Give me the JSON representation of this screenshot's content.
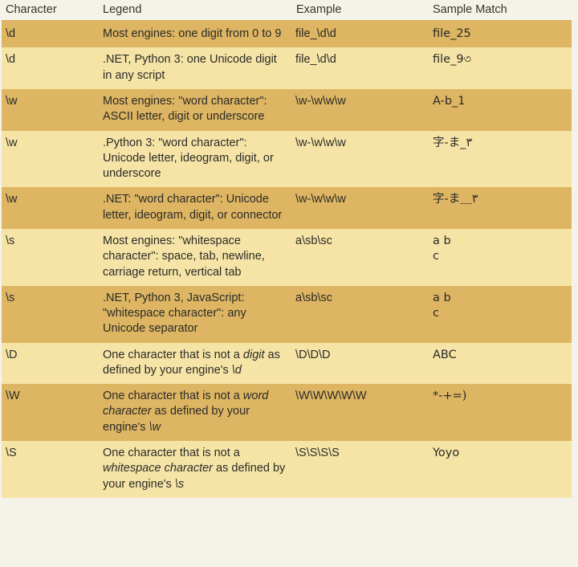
{
  "table": {
    "headers": {
      "character": "Character",
      "legend": "Legend",
      "example": "Example",
      "sample_match": "Sample Match"
    },
    "colors": {
      "band_dark": "#ddb563",
      "band_light": "#f6e4a7",
      "page_background": "#f5f3e9",
      "header_rule": "#d9b45f",
      "text": "#2b2b26"
    },
    "rows": [
      {
        "band": "dark",
        "character": "\\d",
        "legend": "Most engines: one digit from 0 to 9",
        "legend_pre": "Most engines: one digit from 0 to 9",
        "legend_italic": "",
        "legend_post": "",
        "example": "file_\\d\\d",
        "sample_match_line1": "file_25",
        "sample_match_line2": ""
      },
      {
        "band": "light",
        "character": "\\d",
        "legend": ".NET, Python 3: one Unicode digit in any script",
        "legend_pre": ".NET, Python 3: one Unicode digit in any script",
        "legend_italic": "",
        "legend_post": "",
        "example": "file_\\d\\d",
        "sample_match_line1": "file_9৩",
        "sample_match_line2": ""
      },
      {
        "band": "dark",
        "character": "\\w",
        "legend": "Most engines: \"word character\": ASCII letter, digit or underscore",
        "legend_pre": "Most engines: \"word character\": ASCII letter, digit or underscore",
        "legend_italic": "",
        "legend_post": "",
        "example": "\\w-\\w\\w\\w",
        "sample_match_line1": "A-b_1",
        "sample_match_line2": ""
      },
      {
        "band": "light",
        "character": "\\w",
        "legend": ".Python 3: \"word character\": Unicode letter, ideogram, digit, or underscore",
        "legend_pre": ".Python 3: \"word character\": Unicode letter, ideogram, digit, or underscore",
        "legend_italic": "",
        "legend_post": "",
        "example": "\\w-\\w\\w\\w",
        "sample_match_line1": "字-ま_٣",
        "sample_match_line2": ""
      },
      {
        "band": "dark",
        "character": "\\w",
        "legend": ".NET: \"word character\": Unicode letter, ideogram, digit, or connector",
        "legend_pre": ".NET: \"word character\": Unicode letter, ideogram, digit, or connector",
        "legend_italic": "",
        "legend_post": "",
        "example": "\\w-\\w\\w\\w",
        "sample_match_line1": "字-ま＿٣",
        "sample_match_line2": ""
      },
      {
        "band": "light",
        "character": "\\s",
        "legend": "Most engines: \"whitespace character\": space, tab, newline, carriage return, vertical tab",
        "legend_pre": "Most engines: \"whitespace character\": space, tab, newline, carriage return, vertical tab",
        "legend_italic": "",
        "legend_post": "",
        "example": "a\\sb\\sc",
        "sample_match_line1": "a b",
        "sample_match_line2": "c"
      },
      {
        "band": "dark",
        "character": "\\s",
        "legend": ".NET, Python 3, JavaScript: \"whitespace character\": any Unicode separator",
        "legend_pre": ".NET, Python 3, JavaScript: \"whitespace character\": any Unicode separator",
        "legend_italic": "",
        "legend_post": "",
        "example": "a\\sb\\sc",
        "sample_match_line1": "a b",
        "sample_match_line2": "c"
      },
      {
        "band": "light",
        "character": "\\D",
        "legend": "One character that is not a digit as defined by your engine's \\d",
        "legend_pre": "One character that is not a ",
        "legend_italic": "digit",
        "legend_post": " as defined by your engine's ",
        "legend_italic2": "\\d",
        "example": "\\D\\D\\D",
        "sample_match_line1": "ABC",
        "sample_match_line2": ""
      },
      {
        "band": "dark",
        "character": "\\W",
        "legend": "One character that is not a word character as defined by your engine's \\w",
        "legend_pre": "One character that is not a ",
        "legend_italic": "word character",
        "legend_post": " as defined by your engine's ",
        "legend_italic2": "\\w",
        "example": "\\W\\W\\W\\W\\W",
        "sample_match_line1": "*-+=)",
        "sample_match_line2": ""
      },
      {
        "band": "light",
        "character": "\\S",
        "legend": "One character that is not a whitespace character as defined by your engine's \\s",
        "legend_pre": "One character that is not a ",
        "legend_italic": "whitespace character",
        "legend_post": " as defined by your engine's ",
        "legend_italic2": "\\s",
        "example": "\\S\\S\\S\\S",
        "sample_match_line1": "Yoyo",
        "sample_match_line2": ""
      }
    ]
  }
}
